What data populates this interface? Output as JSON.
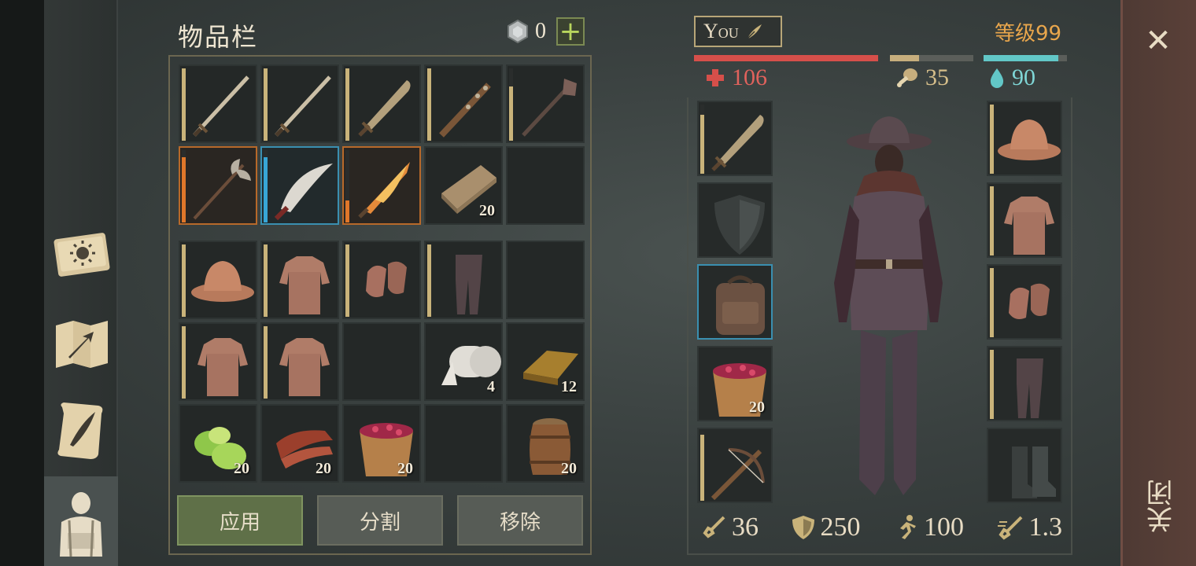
{
  "colors": {
    "background": "#3a4140",
    "accent_gold": "#c9b37a",
    "health": "#d64f4a",
    "food": "#c7ae7d",
    "water": "#62c7c7",
    "level": "#e9a64c",
    "rarity_orange": "#e0772a",
    "rarity_blue": "#38a6d6",
    "apply_button": "#5f7048"
  },
  "side_menu": {
    "items": [
      {
        "icon": "journal-sun-icon"
      },
      {
        "icon": "map-arrow-icon"
      },
      {
        "icon": "scroll-quill-icon"
      },
      {
        "icon": "character-backpack-icon",
        "active": true
      }
    ]
  },
  "inventory": {
    "title": "物品栏",
    "coin_count": "0",
    "add_label": "+",
    "weapons": [
      {
        "icon": "longsword-icon",
        "durability": 1.0,
        "rarity": "common"
      },
      {
        "icon": "longsword-icon",
        "durability": 1.0,
        "rarity": "common"
      },
      {
        "icon": "falchion-icon",
        "durability": 1.0,
        "rarity": "common"
      },
      {
        "icon": "spiked-club-icon",
        "durability": 1.0,
        "rarity": "common"
      },
      {
        "icon": "mace-icon",
        "durability": 0.75,
        "rarity": "common"
      },
      {
        "icon": "halberd-icon",
        "durability": 0.9,
        "rarity": "orange"
      },
      {
        "icon": "scimitar-icon",
        "durability": 0.9,
        "rarity": "blue"
      },
      {
        "icon": "flaming-sword-icon",
        "durability": 0.3,
        "rarity": "orange"
      },
      {
        "icon": "wood-planks-icon",
        "qty": "20"
      },
      {
        "icon": "empty"
      }
    ],
    "gear": [
      {
        "icon": "kettle-helmet-icon",
        "durability": 1.0
      },
      {
        "icon": "chainmail-shirt-icon",
        "durability": 1.0
      },
      {
        "icon": "chainmail-gloves-icon",
        "durability": 1.0
      },
      {
        "icon": "chainmail-leggings-icon",
        "durability": 1.0
      },
      {
        "icon": "empty"
      },
      {
        "icon": "chainmail-shirt-icon",
        "durability": 1.0
      },
      {
        "icon": "chainmail-shirt-icon",
        "durability": 1.0
      },
      {
        "icon": "empty"
      },
      {
        "icon": "cloth-roll-icon",
        "qty": "4"
      },
      {
        "icon": "bronze-ingot-icon",
        "qty": "12"
      },
      {
        "icon": "cabbage-icon",
        "qty": "20"
      },
      {
        "icon": "bacon-icon",
        "qty": "20"
      },
      {
        "icon": "berry-bucket-icon",
        "qty": "20"
      },
      {
        "icon": "empty"
      },
      {
        "icon": "barrel-icon",
        "qty": "20"
      }
    ],
    "buttons": {
      "apply": "应用",
      "split": "分割",
      "remove": "移除"
    }
  },
  "character": {
    "name": "You",
    "level": "等级99",
    "health": "106",
    "food": "35",
    "water": "90",
    "health_pct": 1.0,
    "food_pct": 0.35,
    "water_pct": 0.9,
    "left_slots": [
      {
        "icon": "falchion-icon",
        "durability": 0.85
      },
      {
        "icon": "shield-placeholder-icon"
      },
      {
        "icon": "backpack-icon",
        "highlight": "blue"
      },
      {
        "icon": "berry-bucket-icon",
        "qty": "20"
      },
      {
        "icon": "crossbow-icon",
        "durability": 0.95
      }
    ],
    "right_slots": [
      {
        "icon": "kettle-helmet-icon",
        "durability": 1.0
      },
      {
        "icon": "chainmail-shirt-icon",
        "durability": 1.0
      },
      {
        "icon": "chainmail-gloves-icon",
        "durability": 1.0
      },
      {
        "icon": "chainmail-leggings-icon",
        "durability": 1.0
      },
      {
        "icon": "boots-placeholder-icon"
      }
    ],
    "stats": {
      "attack": "36",
      "armor": "250",
      "speed": "100",
      "attack_speed": "1.3"
    }
  },
  "close": {
    "icon": "close-icon",
    "label": "关闭"
  }
}
